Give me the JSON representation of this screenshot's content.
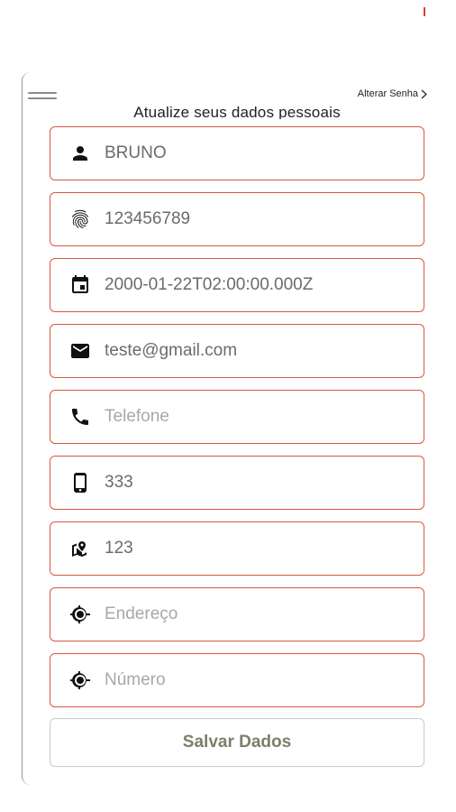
{
  "header": {
    "change_password_label": "Alterar Senha",
    "title": "Atualize seus dados pessoais"
  },
  "form": {
    "fields": [
      {
        "icon": "person-icon",
        "value": "BRUNO",
        "placeholder": ""
      },
      {
        "icon": "fingerprint-icon",
        "value": "123456789",
        "placeholder": ""
      },
      {
        "icon": "calendar-icon",
        "value": "2000-01-22T02:00:00.000Z",
        "placeholder": ""
      },
      {
        "icon": "email-icon",
        "value": "teste@gmail.com",
        "placeholder": ""
      },
      {
        "icon": "phone-icon",
        "value": "",
        "placeholder": "Telefone"
      },
      {
        "icon": "mobile-icon",
        "value": "333",
        "placeholder": ""
      },
      {
        "icon": "map-pin-icon",
        "value": "123",
        "placeholder": ""
      },
      {
        "icon": "location-target-icon",
        "value": "",
        "placeholder": "Endereço"
      },
      {
        "icon": "location-target-icon",
        "value": "",
        "placeholder": "Número"
      }
    ],
    "save_label": "Salvar Dados"
  },
  "colors": {
    "field_border": "#d9573f",
    "save_text": "#7b7f68",
    "accent_tick": "#e53935"
  }
}
